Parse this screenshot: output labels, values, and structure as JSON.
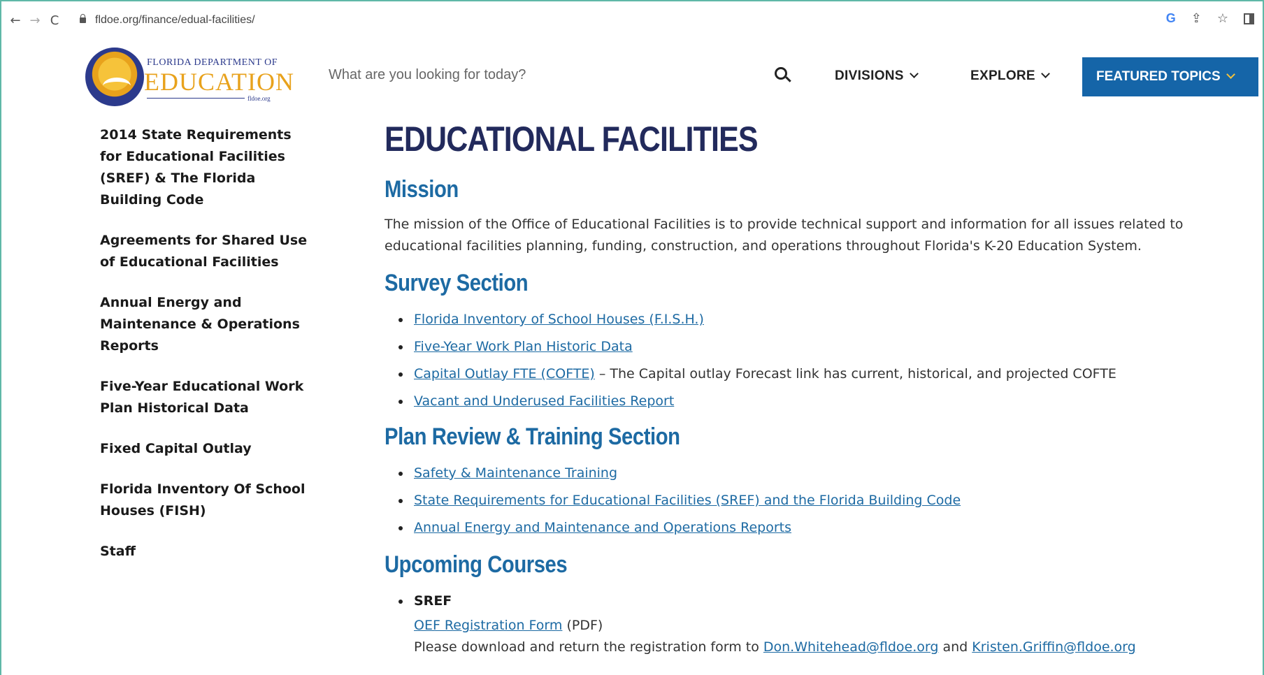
{
  "browser": {
    "back": "←",
    "forward": "→",
    "reload": "C",
    "url": "fldoe.org/finance/edual-facilities/"
  },
  "header": {
    "logo_top": "FLORIDA DEPARTMENT OF",
    "logo_main": "EDUCATION",
    "logo_sub": "fldoe.org",
    "search_placeholder": "What are you looking for today?",
    "menu_divisions": "DIVISIONS",
    "menu_explore": "EXPLORE",
    "menu_featured": "FEATURED TOPICS",
    "featured_bg": "#1565a8"
  },
  "sidebar": {
    "items": [
      {
        "label": "2014 State Requirements for Educational Facilities (SREF) & The Florida Building Code"
      },
      {
        "label": "Agreements for Shared Use of Educational Facilities"
      },
      {
        "label": "Annual Energy and Maintenance & Operations Reports"
      },
      {
        "label": "Five-Year Educational Work Plan Historical Data"
      },
      {
        "label": "Fixed Capital Outlay"
      },
      {
        "label": "Florida Inventory Of School Houses (FISH)"
      },
      {
        "label": "Staff"
      }
    ]
  },
  "main": {
    "title": "EDUCATIONAL FACILITIES",
    "mission_heading": "Mission",
    "mission_text": "The mission of the Office of Educational Facilities is to provide technical support and information for all issues related to educational facilities planning, funding, construction, and operations throughout Florida's K-20 Education System.",
    "survey_heading": "Survey Section",
    "survey_links": {
      "fish": "Florida Inventory of School Houses (F.I.S.H.)",
      "workplan": "Five-Year Work Plan Historic Data",
      "cofte": "Capital Outlay FTE (COFTE)",
      "cofte_note": " – The Capital outlay Forecast link has current, historical, and projected COFTE",
      "vacant": "Vacant and Underused Facilities Report"
    },
    "plan_heading": "Plan Review & Training Section",
    "plan_links": {
      "safety": "Safety & Maintenance Training",
      "sref": "State Requirements for Educational Facilities (SREF) and the Florida Building Code",
      "energy": "Annual Energy and Maintenance and Operations Reports"
    },
    "upcoming_heading": "Upcoming Courses",
    "course_name": "SREF",
    "reg_form_link": "OEF Registration Form",
    "reg_form_suffix": " (PDF)",
    "reg_text": "Please download and return the registration form to ",
    "email1": "Don.Whitehead@fldoe.org",
    "and_text": " and ",
    "email2": "Kristen.Griffin@fldoe.org"
  }
}
